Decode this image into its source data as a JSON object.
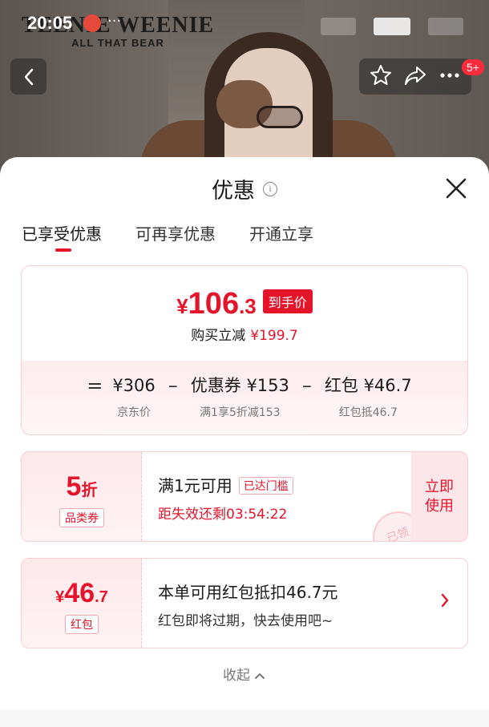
{
  "status_bar": {
    "time": "20:05",
    "more": "···"
  },
  "brand": {
    "name": "TEENIE WEENIE",
    "tagline": "ALL THAT BEAR"
  },
  "header": {
    "message_badge": "5+"
  },
  "sheet": {
    "title": "优惠",
    "tabs": [
      {
        "label": "已享受优惠",
        "active": true
      },
      {
        "label": "可再享优惠",
        "active": false
      },
      {
        "label": "开通立享",
        "active": false
      }
    ]
  },
  "price_card": {
    "currency": "¥",
    "price_int": "106",
    "price_dec": ".3",
    "price_tag": "到手价",
    "sub_label": "购买立减",
    "sub_amount": "¥199.7",
    "formula": {
      "op_eq": "=",
      "op_minus": "–",
      "items": [
        {
          "amount": "¥306",
          "label": "京东价"
        },
        {
          "amount": "优惠券 ¥153",
          "label": "满1享5折减153"
        },
        {
          "amount": "红包 ¥46.7",
          "label": "红包抵46.7"
        }
      ]
    }
  },
  "coupon": {
    "discount_num": "5",
    "discount_unit": "折",
    "type_label": "品类券",
    "title": "满1元可用",
    "chip": "已达门槛",
    "countdown": "距失效还剩03:54:22",
    "use_button": "立即使用",
    "stamp": "已领"
  },
  "redpacket": {
    "currency": "¥",
    "amount_int": "46",
    "amount_dec": ".7",
    "type_label": "红包",
    "title": "本单可用红包抵扣46.7元",
    "desc": "红包即将过期，快去使用吧~"
  },
  "collapse_label": "收起",
  "colors": {
    "accent": "#e4142b",
    "soft_pink": "#fde8ea"
  }
}
